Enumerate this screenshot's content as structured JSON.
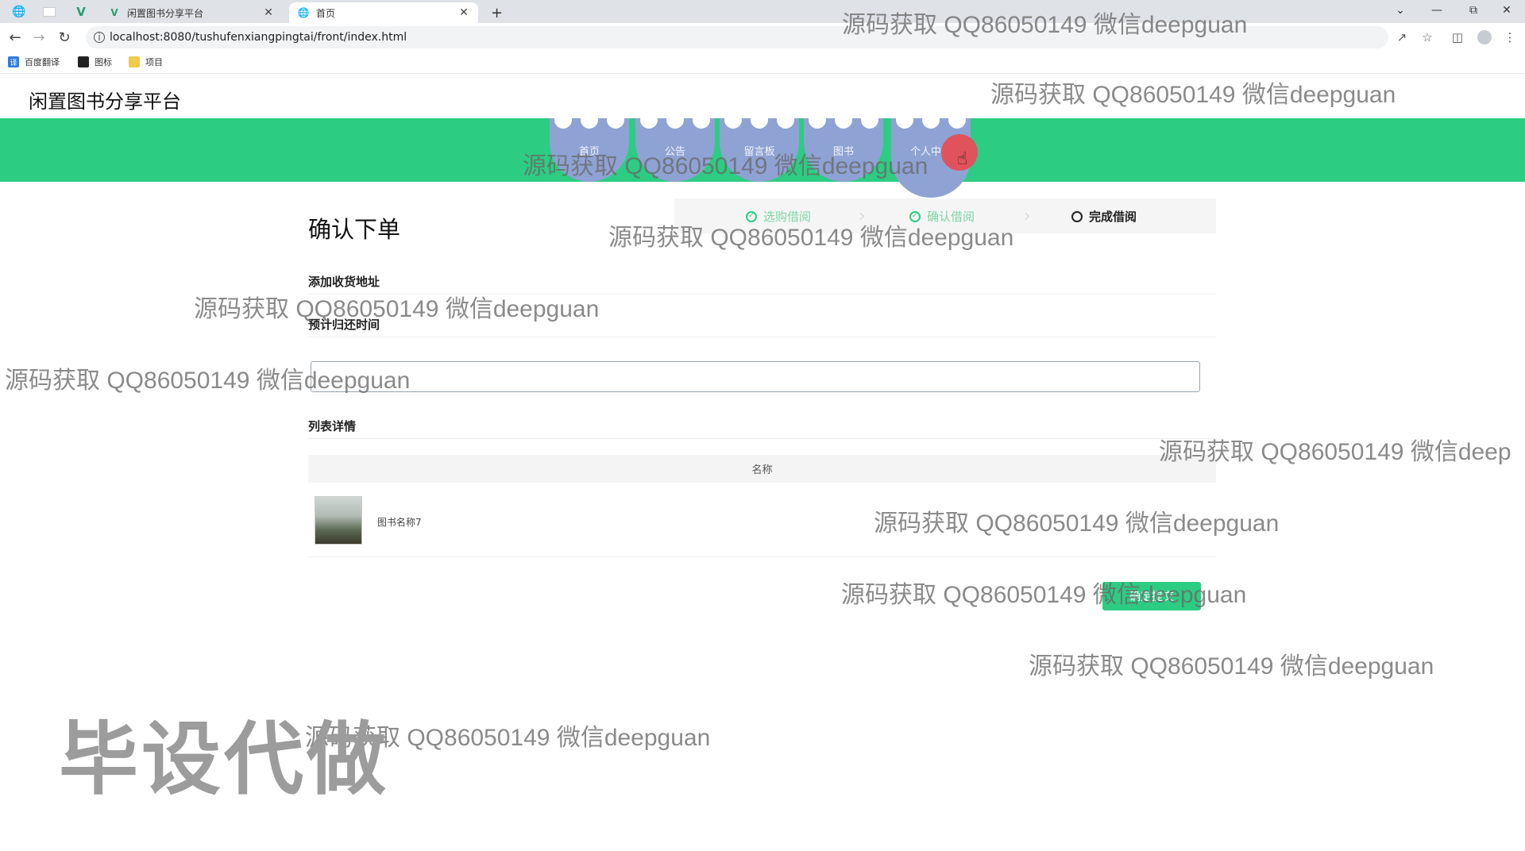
{
  "browser": {
    "tabs": [
      {
        "label": "闲置图书分享平台",
        "active": false
      },
      {
        "label": "首页",
        "active": true
      }
    ],
    "new_tab_symbol": "+",
    "url": "localhost:8080/tushufenxiangpingtai/front/index.html",
    "bookmarks": [
      {
        "label": "百度翻译",
        "icon": "translate-icon"
      },
      {
        "label": "图标",
        "icon": "image-icon"
      },
      {
        "label": "项目",
        "icon": "folder-icon"
      }
    ]
  },
  "site": {
    "title": "闲置图书分享平台",
    "nav": [
      "首页",
      "公告",
      "留言板",
      "图书",
      "个人中心"
    ],
    "nav_active_index": 4,
    "accent_color": "#2ccd82",
    "nav_item_color": "#8fa2d4"
  },
  "order": {
    "heading": "确认下单",
    "steps": [
      {
        "label": "选购借阅",
        "status": "done"
      },
      {
        "label": "确认借阅",
        "status": "done"
      },
      {
        "label": "完成借阅",
        "status": "todo"
      }
    ],
    "address_label": "添加收货地址",
    "return_time_label": "预计归还时间",
    "return_time_value": "",
    "list_label": "列表详情",
    "table_header": "名称",
    "items": [
      {
        "name": "图书名称7"
      }
    ],
    "submit_label": "确定提交"
  },
  "overlay": {
    "watermark": "源码获取 QQ86050149 微信deepguan",
    "watermark_cut": "源码获取 QQ86050149 微信deep",
    "stamp": "毕设代做"
  }
}
